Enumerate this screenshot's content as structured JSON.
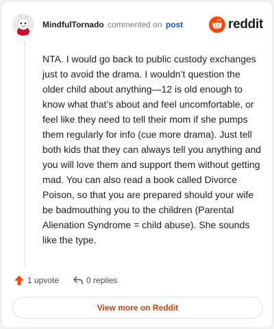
{
  "header": {
    "username": "MindfulTornado",
    "action_text": "commented on",
    "post_link": "post",
    "logo_text": "reddit"
  },
  "comment": {
    "body": "NTA. I would go back to public custody exchanges just to avoid the drama. I wouldn’t question the older child about anything—12 is old enough to know what that’s about and feel uncomfortable, or feel like they need to tell their mom if she pumps them regularly for info (cue more drama). Just tell both kids that they can always tell you anything and you will love them and support them without getting mad. You can also read a book called Divorce Poison, so that you are prepared should your wife be badmouthing you to the children (Parental Alienation Syndrome = child abuse). She sounds like the type."
  },
  "actions": {
    "upvotes_label": "1 upvote",
    "replies_label": "0 replies"
  },
  "footer": {
    "view_more_label": "View more on Reddit"
  },
  "colors": {
    "brand": "#ff4500",
    "link": "#0b57d0",
    "button_text": "#d93a00"
  },
  "icons": [
    "avatar",
    "reddit-snoo-icon",
    "upvote-arrow-icon",
    "reply-icon"
  ]
}
